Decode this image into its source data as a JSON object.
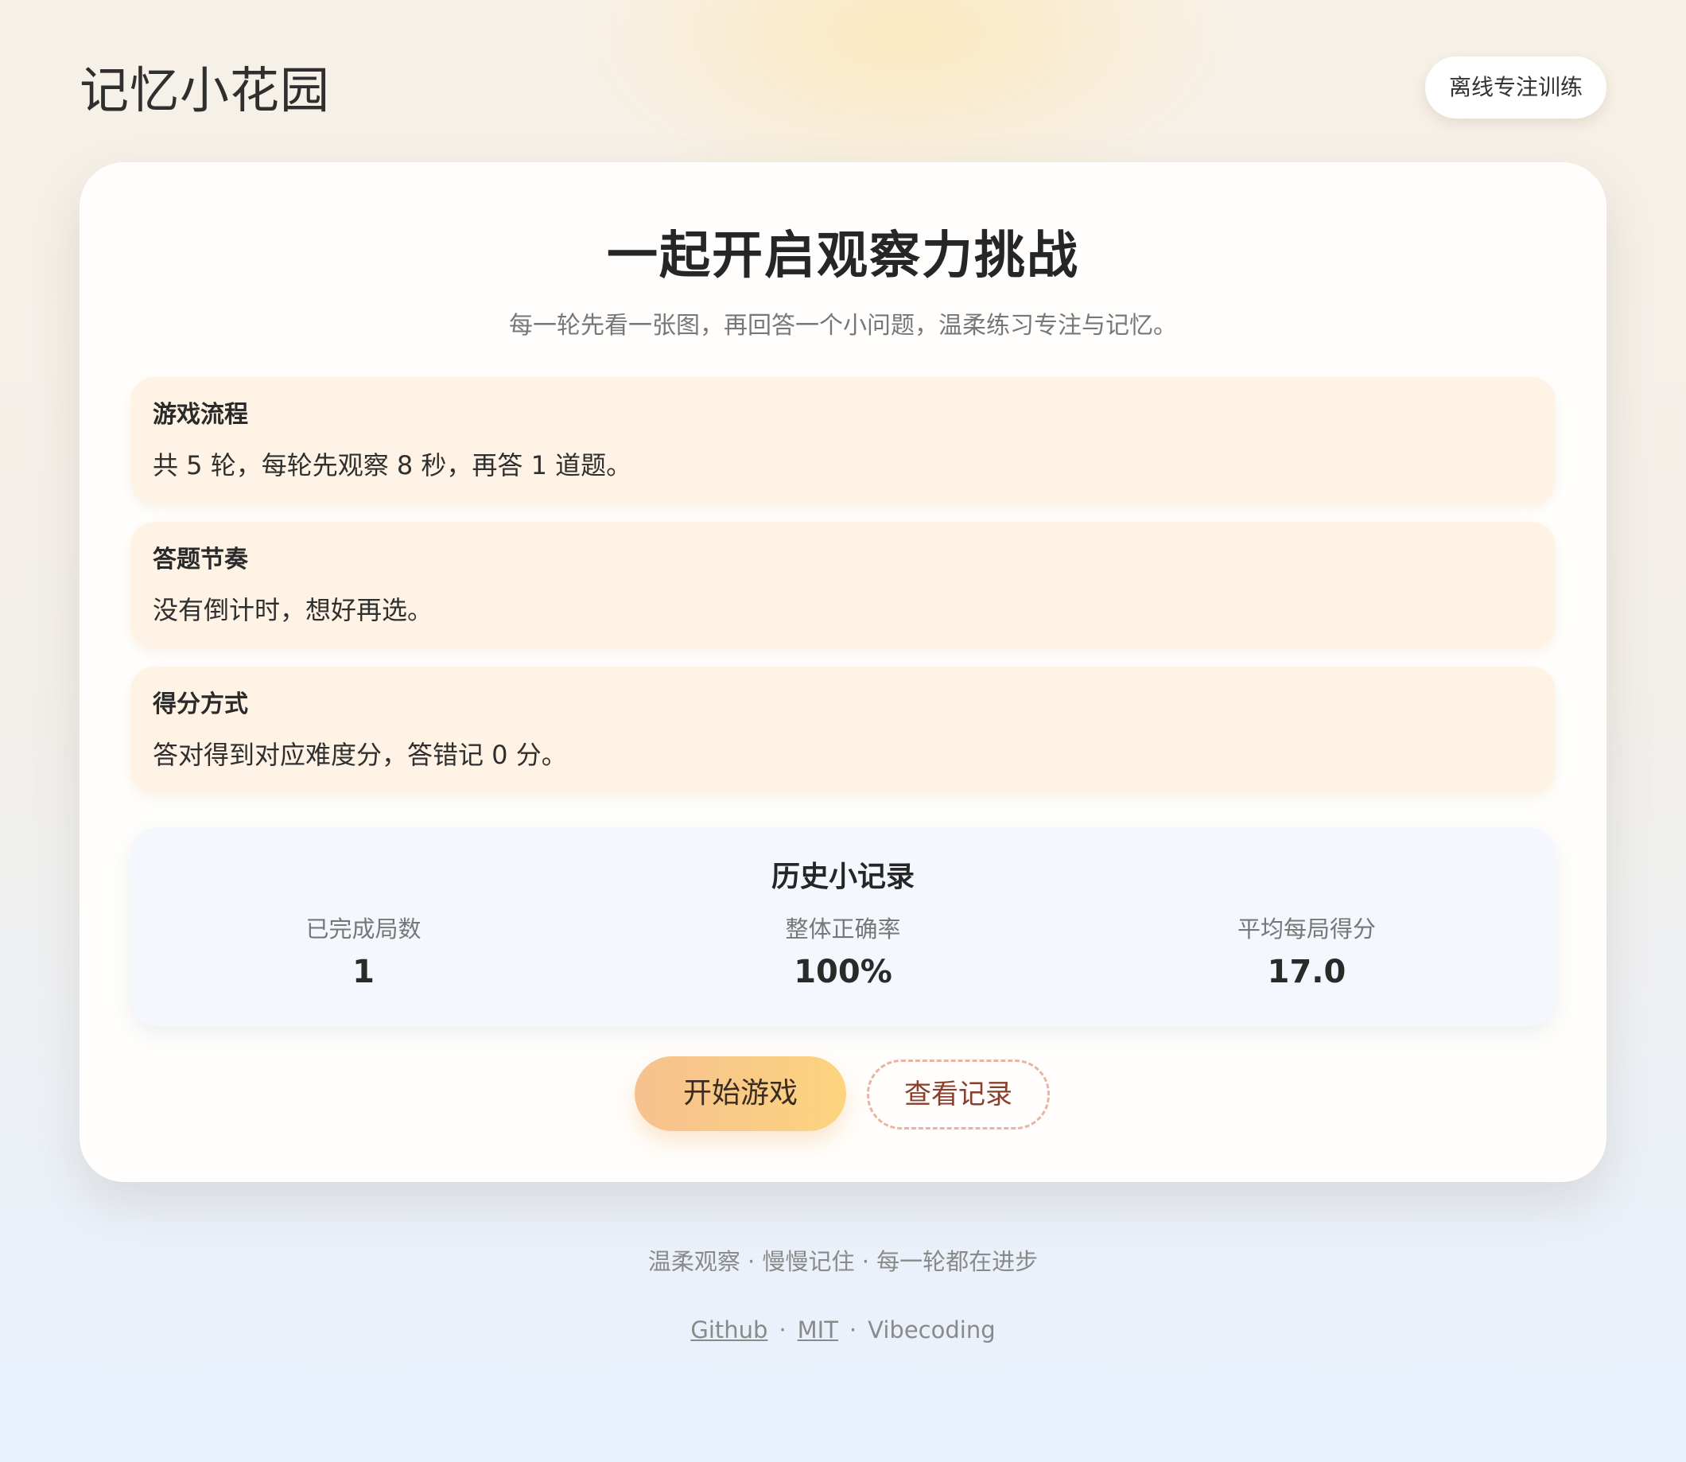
{
  "header": {
    "app_title": "记忆小花园",
    "offline_button": "离线专注训练"
  },
  "hero": {
    "title": "一起开启观察力挑战",
    "subtitle": "每一轮先看一张图，再回答一个小问题，温柔练习专注与记忆。"
  },
  "info_cards": [
    {
      "title": "游戏流程",
      "body": "共 5 轮，每轮先观察 8 秒，再答 1 道题。"
    },
    {
      "title": "答题节奏",
      "body": "没有倒计时，想好再选。"
    },
    {
      "title": "得分方式",
      "body": "答对得到对应难度分，答错记 0 分。"
    }
  ],
  "history": {
    "title": "历史小记录",
    "stats": [
      {
        "label": "已完成局数",
        "value": "1"
      },
      {
        "label": "整体正确率",
        "value": "100%"
      },
      {
        "label": "平均每局得分",
        "value": "17.0"
      }
    ]
  },
  "actions": {
    "start": "开始游戏",
    "records": "查看记录"
  },
  "footer": {
    "tagline": "温柔观察 · 慢慢记住 · 每一轮都在进步",
    "links": [
      "Github",
      "MIT"
    ],
    "separator": "·",
    "vibecoding": "Vibecoding"
  },
  "colors": {
    "primary_gradient_start": "#f6c18e",
    "primary_gradient_end": "#fcd47f",
    "info_card_bg": "#fef3e4",
    "history_bg": "#f4f8fe",
    "dashed_border": "#eab3a4"
  }
}
